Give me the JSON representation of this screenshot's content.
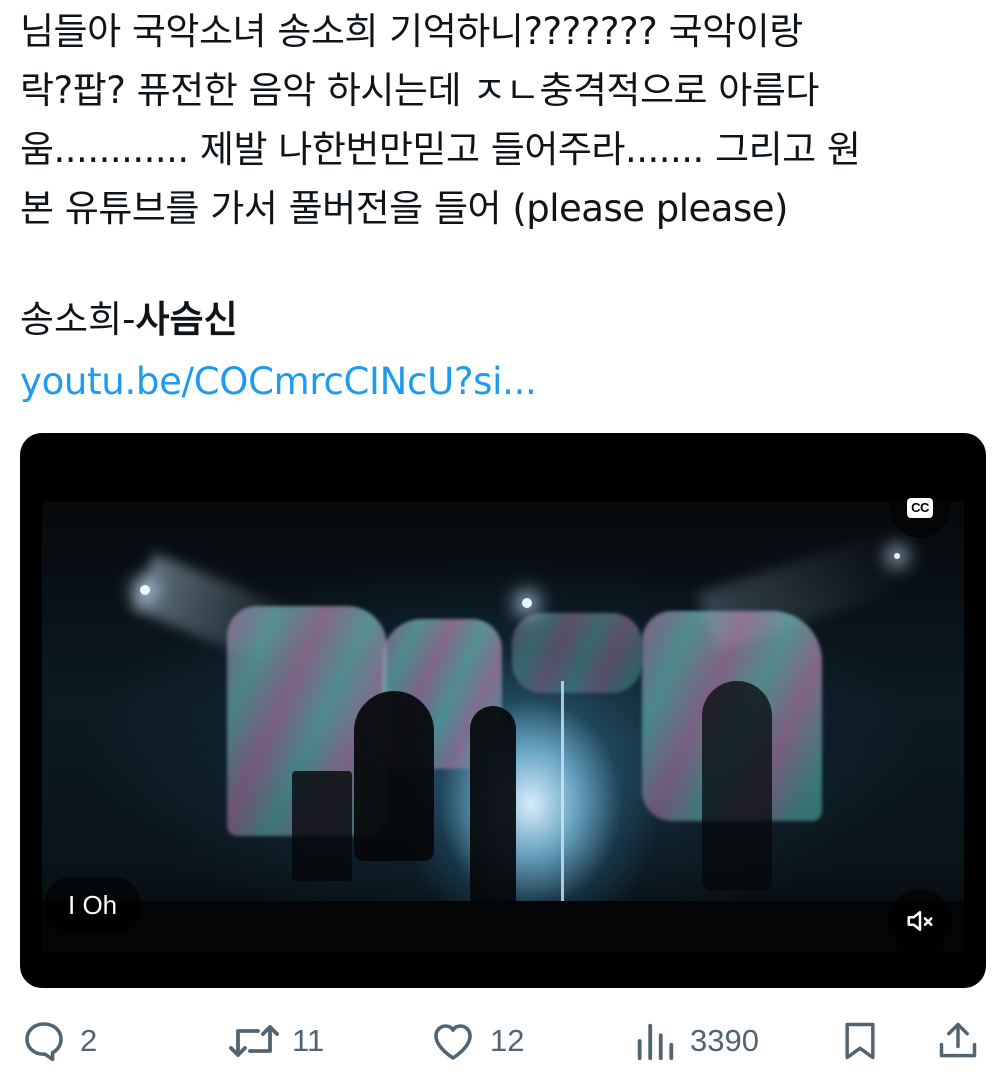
{
  "tweet": {
    "text_lines": [
      "님들아 국악소녀 송소희 기억하니??????? 국악이랑",
      "락?팝? 퓨전한 음악 하시는데 ㅈㄴ충격적으로 아름다",
      "움............ 제발 나한번만믿고 들어주라....... 그리고 원",
      "본 유튜브를 가서 풀버전을 들어 (please please)"
    ],
    "song_artist": "송소희-",
    "song_title": "사슴신",
    "link_text": "youtu.be/COCmrcCINcU?si..."
  },
  "video": {
    "cc_label": "CC",
    "caption": "I Oh",
    "mute_icon": "muted-speaker-icon"
  },
  "actions": {
    "reply_count": "2",
    "retweet_count": "11",
    "like_count": "12",
    "views_count": "3390"
  },
  "colors": {
    "link": "#1d9bf0",
    "action_gray": "#536471",
    "text": "#0f1419"
  }
}
